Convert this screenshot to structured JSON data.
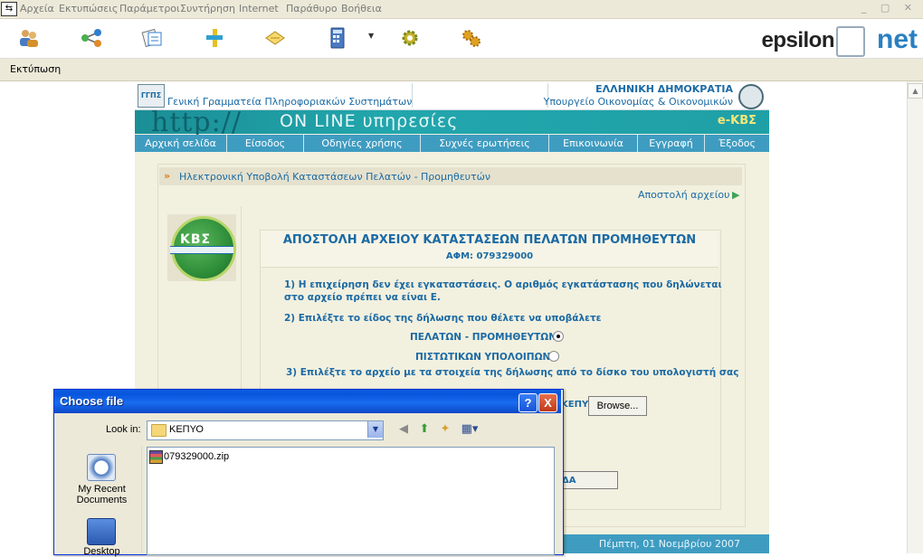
{
  "menubar": {
    "items": [
      "Αρχεία",
      "Εκτυπώσεις",
      "Παράμετροι",
      "Συντήρηση",
      "Internet",
      "Παράθυρο",
      "Βοήθεια"
    ]
  },
  "toolbar": {
    "icons": [
      "users-icon",
      "network-icon",
      "documents-icon",
      "tools-icon",
      "notebook-icon",
      "calculator-icon",
      "gear-icon",
      "gears-icon"
    ]
  },
  "logo": {
    "part1": "epsilon",
    "part2": "net"
  },
  "print_bar": {
    "label": "Εκτύπωση"
  },
  "site_header": {
    "left_text": "Γενική Γραμματεία Πληροφοριακών Συστημάτων",
    "right_line1": "ΕΛΛΗΝΙΚΗ ΔΗΜΟΚΡΑΤΙΑ",
    "right_line2": "Υπουργείο Οικονομίας & Οικονομικών"
  },
  "banner": {
    "http": "http://",
    "online": "ON LINE υπηρεσίες",
    "service": "e-ΚΒΣ"
  },
  "nav": [
    "Αρχική σελίδα",
    "Είσοδος",
    "Οδηγίες χρήσης",
    "Συχνές ερωτήσεις",
    "Επικοινωνία",
    "Εγγραφή",
    "Έξοδος"
  ],
  "content": {
    "section_title": "Ηλεκτρονική Υποβολή Καταστάσεων Πελατών - Προμηθευτών",
    "send_link": "Αποστολή αρχείου",
    "logo_text": "ΚΒΣ"
  },
  "form": {
    "title": "ΑΠΟΣΤΟΛΗ ΑΡΧΕΙΟΥ ΚΑΤΑΣΤΑΣΕΩΝ ΠΕΛΑΤΩΝ ΠΡΟΜΗΘΕΥΤΩΝ",
    "afm": "ΑΦΜ: 079329000",
    "step1_line1": "1) Η επιχείρηση δεν έχει εγκαταστάσεις. Ο αριθμός εγκατάστασης που δηλώνεται",
    "step1_line2": "στο αρχείο πρέπει να είναι Ε.",
    "step2": "2) Επιλέξτε το είδος της δήλωσης που θέλετε να υποβάλετε",
    "radio1_label": "ΠΕΛΑΤΩΝ - ΠΡΟΜΗΘΕΥΤΩΝ:",
    "radio1_selected": true,
    "radio2_label": "ΠΙΣΤΩΤΙΚΩΝ ΥΠΟΛΟΙΠΩΝ:",
    "radio2_selected": false,
    "step3": "3) Επιλέξτε το αρχείο με τα στοιχεία της δήλωσης από το δίσκο του υπολογιστή σας",
    "file_field_visible": "ΚΕΠΥΟ",
    "browse_label": "Browse...",
    "submit_visible": "ΔΑ"
  },
  "status": {
    "date": "Πέμπτη, 01 Νοεμβρίου 2007"
  },
  "dialog": {
    "title": "Choose file",
    "help": "?",
    "close": "X",
    "look_in_label": "Look in:",
    "look_in_value": "ΚΕΠΥΟ",
    "places": [
      "My Recent Documents",
      "Desktop"
    ],
    "files": [
      "079329000.zip"
    ]
  }
}
